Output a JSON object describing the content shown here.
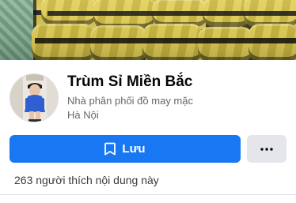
{
  "cover": {
    "description_icon": "cover-photo-bundles"
  },
  "profile": {
    "name": "Trùm Sỉ Miền Bắc",
    "category": "Nhà phân phối đồ may mặc",
    "location": "Hà Nội"
  },
  "actions": {
    "save_label": "Lưu",
    "save_icon": "bookmark-icon",
    "more_icon": "ellipsis-icon"
  },
  "stats": {
    "likes_text": "263 người thích nội dung này"
  },
  "colors": {
    "primary": "#1877f2",
    "secondary_button": "#e4e6eb",
    "text_primary": "#050505",
    "text_secondary": "#65676b"
  }
}
